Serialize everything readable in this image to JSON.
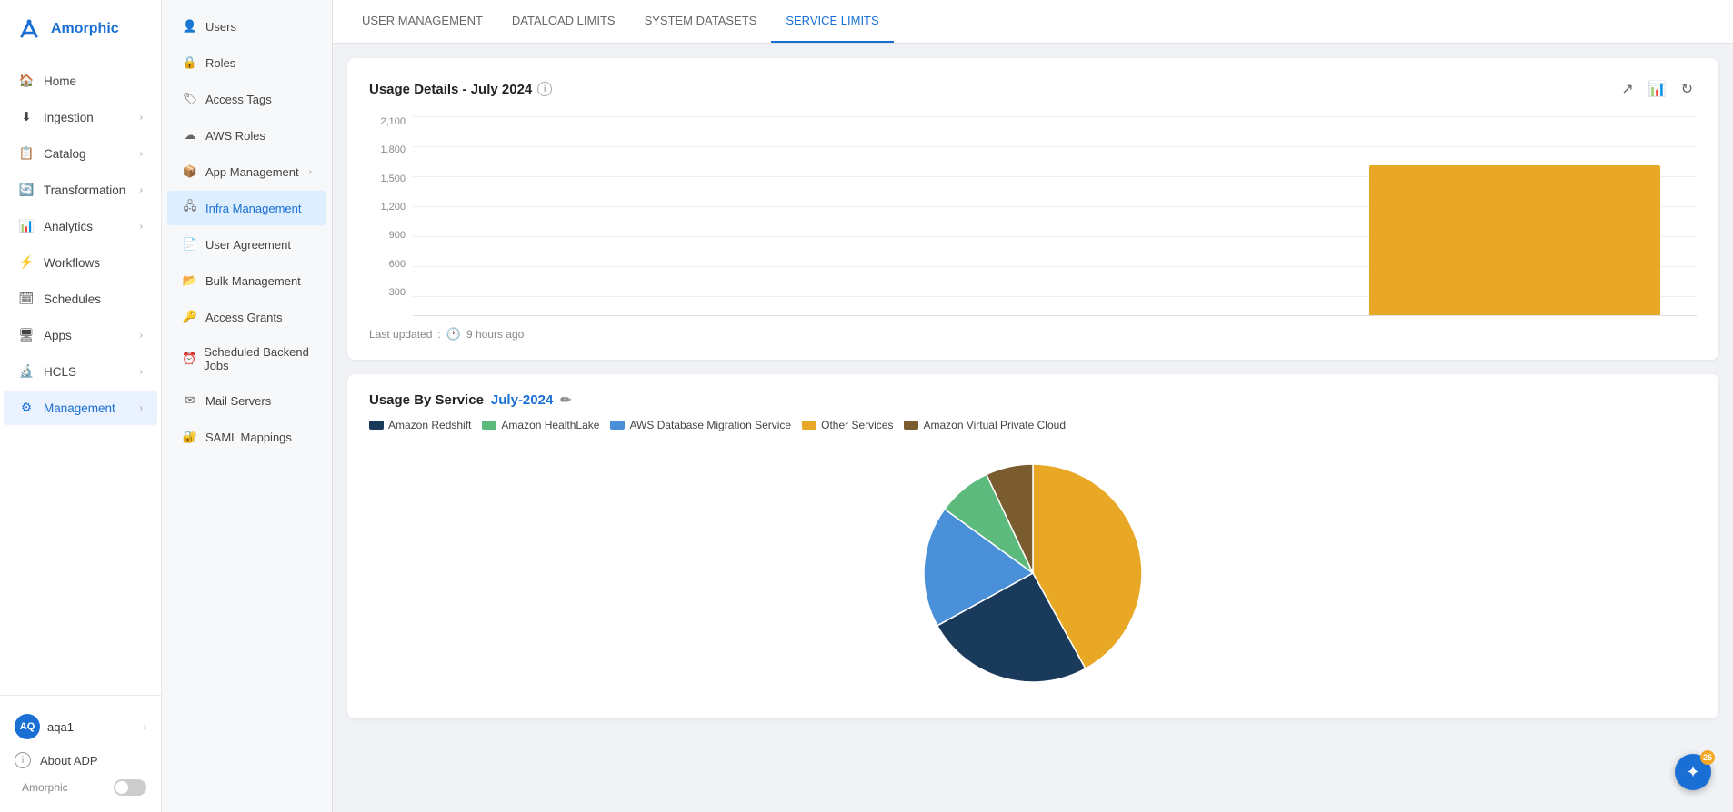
{
  "app": {
    "name": "Amorphic"
  },
  "sidebar": {
    "nav_items": [
      {
        "id": "home",
        "label": "Home",
        "icon": "🏠",
        "has_chevron": false
      },
      {
        "id": "ingestion",
        "label": "Ingestion",
        "icon": "⬇",
        "has_chevron": true
      },
      {
        "id": "catalog",
        "label": "Catalog",
        "icon": "📋",
        "has_chevron": true
      },
      {
        "id": "transformation",
        "label": "Transformation",
        "icon": "🔄",
        "has_chevron": true
      },
      {
        "id": "analytics",
        "label": "Analytics",
        "icon": "📊",
        "has_chevron": true
      },
      {
        "id": "workflows",
        "label": "Workflows",
        "icon": "⚡",
        "has_chevron": false
      },
      {
        "id": "schedules",
        "label": "Schedules",
        "icon": "🗓",
        "has_chevron": false
      },
      {
        "id": "apps",
        "label": "Apps",
        "icon": "🖥",
        "has_chevron": true
      },
      {
        "id": "hcls",
        "label": "HCLS",
        "icon": "🔬",
        "has_chevron": true
      },
      {
        "id": "management",
        "label": "Management",
        "icon": "⚙",
        "has_chevron": true,
        "active": true
      }
    ],
    "user": {
      "initials": "AQ",
      "name": "aqa1"
    },
    "about_label": "About ADP",
    "brand": "Amorphic",
    "toggle_state": false
  },
  "submenu": {
    "items": [
      {
        "id": "users",
        "label": "Users",
        "icon": "👤",
        "has_chevron": false
      },
      {
        "id": "roles",
        "label": "Roles",
        "icon": "🔒",
        "has_chevron": false
      },
      {
        "id": "access-tags",
        "label": "Access Tags",
        "icon": "🏷",
        "has_chevron": false
      },
      {
        "id": "aws-roles",
        "label": "AWS Roles",
        "icon": "☁",
        "has_chevron": false
      },
      {
        "id": "app-management",
        "label": "App Management",
        "icon": "📦",
        "has_chevron": true
      },
      {
        "id": "infra-management",
        "label": "Infra Management",
        "icon": "🖧",
        "has_chevron": false,
        "active": true
      },
      {
        "id": "user-agreement",
        "label": "User Agreement",
        "icon": "📄",
        "has_chevron": false
      },
      {
        "id": "bulk-management",
        "label": "Bulk Management",
        "icon": "📂",
        "has_chevron": false
      },
      {
        "id": "access-grants",
        "label": "Access Grants",
        "icon": "🔑",
        "has_chevron": false
      },
      {
        "id": "scheduled-backend-jobs",
        "label": "Scheduled Backend Jobs",
        "icon": "⏰",
        "has_chevron": false
      },
      {
        "id": "mail-servers",
        "label": "Mail Servers",
        "icon": "✉",
        "has_chevron": false
      },
      {
        "id": "saml-mappings",
        "label": "SAML Mappings",
        "icon": "🔐",
        "has_chevron": false
      }
    ]
  },
  "tabs": [
    {
      "id": "user-management",
      "label": "USER MANAGEMENT",
      "active": false
    },
    {
      "id": "dataload-limits",
      "label": "DATALOAD LIMITS",
      "active": false
    },
    {
      "id": "system-datasets",
      "label": "SYSTEM DATASETS",
      "active": false
    },
    {
      "id": "service-limits",
      "label": "SERVICE LIMITS",
      "active": true
    }
  ],
  "usage_details": {
    "title": "Usage Details - July 2024",
    "last_updated_label": "Last updated",
    "last_updated_value": "9 hours ago",
    "y_labels": [
      "2,100",
      "1,800",
      "1,500",
      "1,200",
      "900",
      "600",
      "300"
    ],
    "bar_color": "#e8a825"
  },
  "usage_by_service": {
    "title": "Usage By Service",
    "month": "July-2024",
    "legend": [
      {
        "label": "Amazon Redshift",
        "color": "#1a3a5c"
      },
      {
        "label": "Amazon HealthLake",
        "color": "#5dba7d"
      },
      {
        "label": "AWS Database Migration Service",
        "color": "#4a90d9"
      },
      {
        "label": "Other Services",
        "color": "#e8a825"
      },
      {
        "label": "Amazon Virtual Private Cloud",
        "color": "#7a5c2e"
      }
    ],
    "pie_segments": [
      {
        "label": "Other Services",
        "color": "#e8a825",
        "percent": 42
      },
      {
        "label": "Amazon Redshift",
        "color": "#1a3a5c",
        "percent": 25
      },
      {
        "label": "AWS Database Migration Service",
        "color": "#4a90d9",
        "percent": 18
      },
      {
        "label": "Amazon HealthLake",
        "color": "#5dba7d",
        "percent": 8
      },
      {
        "label": "Amazon Virtual Private Cloud",
        "color": "#7a5c2e",
        "percent": 7
      }
    ]
  },
  "float_button": {
    "badge": "25",
    "icon": "✦"
  }
}
